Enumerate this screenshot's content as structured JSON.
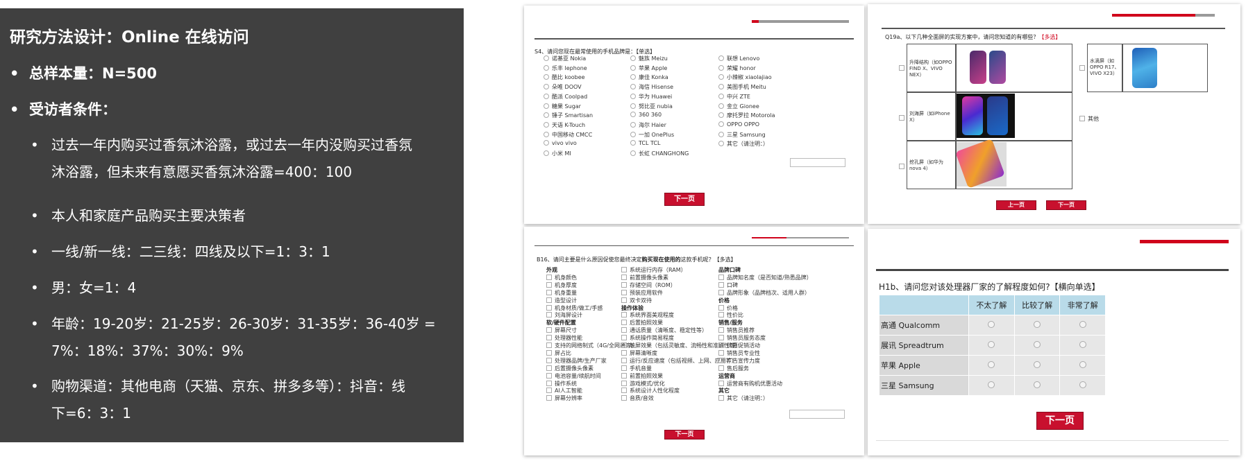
{
  "slide": {
    "title": "研究方法设计：Online 在线访问",
    "bullets": [
      {
        "dot": "•",
        "text": "总样本量：N=500"
      },
      {
        "dot": "•",
        "text": "受访者条件："
      }
    ],
    "sub_bullets": [
      {
        "dot": "•",
        "line1": "过去一年内购买过香氛沐浴露，或过去一年内没购买过香氛",
        "line2": "沐浴露，但未来有意愿买香氛沐浴露=400：100"
      },
      {
        "dot": "•",
        "line1": "本人和家庭产品购买主要决策者",
        "line2": ""
      },
      {
        "dot": "•",
        "line1": "一线/新一线：二三线：四线及以下=1：3：1",
        "line2": ""
      },
      {
        "dot": "•",
        "line1": "男：女=1：4",
        "line2": ""
      },
      {
        "dot": "•",
        "line1": "年龄：19-20岁：21-25岁：26-30岁：31-35岁：36-40岁 =",
        "line2": "7%：18%：37%：30%：9%"
      },
      {
        "dot": "•",
        "line1": "购物渠道：其他电商（天猫、京东、拼多多等）：抖音：线",
        "line2": "下=6：3：1"
      }
    ]
  },
  "s4": {
    "question": "S4、请问您现在最常使用的手机品牌是：【单选】",
    "col1": [
      "诺基亚 Nokia",
      "乐丰 lephone",
      "酷比 koobee",
      "朵唯 DOOV",
      "酷派 Coolpad",
      "糖果 Sugar",
      "锤子 Smartisan",
      "天语 K-Touch",
      "中国移动 CMCC",
      "vivo vivo",
      "小米 MI"
    ],
    "col2": [
      "魅族 Meizu",
      "苹果 Apple",
      "康佳 Konka",
      "海信 Hisense",
      "华为 Huawei",
      "努比亚 nubia",
      "360 360",
      "海尔 Haier",
      "一加 OnePlus",
      "TCL TCL",
      "长虹 CHANGHONG"
    ],
    "col3": [
      "联想 Lenovo",
      "荣耀 honor",
      "小辣椒 xiaolajiao",
      "美图手机 Meitu",
      "中兴 ZTE",
      "金立 Gionee",
      "摩托罗拉 Motorola",
      "OPPO OPPO",
      "三星 Samsung",
      "其它（请注明：）"
    ],
    "next_label": "下一页"
  },
  "q19a": {
    "question": "Q19a、以下几种全面屏的实现方案中，请问您知道的有哪些？",
    "tag": "【多选】",
    "options": [
      {
        "line1": "升降结构（如OPPO",
        "line2": "FIND X、VIVO",
        "line3": "NEX）"
      },
      {
        "line1": "水滴屏（如",
        "line2": "OPPO R17、",
        "line3": "VIVO X23）"
      },
      {
        "line1": "刘海屏（如iPhone",
        "line2": "X）",
        "line3": ""
      },
      {
        "line1": "挖孔屏（如华为",
        "line2": "nova 4）",
        "line3": ""
      }
    ],
    "other_label": "其他",
    "prev_label": "上一页",
    "next_label": "下一页"
  },
  "b16": {
    "question_pre": "B16、请问主要是什么原因促使您最终决定",
    "question_bold": "购买现在使用的",
    "question_post": "这款手机呢？【多选】",
    "col1": [
      {
        "t": "g",
        "v": "外观"
      },
      {
        "t": "o",
        "v": "机身颜色"
      },
      {
        "t": "o",
        "v": "机身厚度"
      },
      {
        "t": "o",
        "v": "机身重量"
      },
      {
        "t": "o",
        "v": "造型设计"
      },
      {
        "t": "o",
        "v": "机身材质/做工/手感"
      },
      {
        "t": "o",
        "v": "刘海屏设计"
      },
      {
        "t": "g",
        "v": "软/硬件配置"
      },
      {
        "t": "o",
        "v": "屏幕尺寸"
      },
      {
        "t": "o",
        "v": "处理器性能"
      },
      {
        "t": "o",
        "v": "支持的网络制式（4G/全网通等）"
      },
      {
        "t": "o",
        "v": "屏占比"
      },
      {
        "t": "o",
        "v": "处理器品牌/生产厂家"
      },
      {
        "t": "o",
        "v": "后置摄像头像素"
      },
      {
        "t": "o",
        "v": "电池容量/续航时间"
      },
      {
        "t": "o",
        "v": "操作系统"
      },
      {
        "t": "o",
        "v": "AI人工智能"
      },
      {
        "t": "o",
        "v": "屏幕分辨率"
      }
    ],
    "col2": [
      {
        "t": "o",
        "v": "系统运行内存（RAM）"
      },
      {
        "t": "o",
        "v": "前置摄像头像素"
      },
      {
        "t": "o",
        "v": "存储空间（ROM）"
      },
      {
        "t": "o",
        "v": "预装应用软件"
      },
      {
        "t": "o",
        "v": "双卡双待"
      },
      {
        "t": "g",
        "v": "操作体验"
      },
      {
        "t": "o",
        "v": "系统界面美观程度"
      },
      {
        "t": "o",
        "v": "后置拍照效果"
      },
      {
        "t": "o",
        "v": "通话质量（清晰度、稳定性等）"
      },
      {
        "t": "o",
        "v": "系统操作简易程度"
      },
      {
        "t": "o",
        "v": "触屏效果（包括灵敏度、流畅性和准确性等）"
      },
      {
        "t": "o",
        "v": "屏幕清晰度"
      },
      {
        "t": "o",
        "v": "运行/反应速度（包括视频、上网、应用等）"
      },
      {
        "t": "o",
        "v": "手机音量"
      },
      {
        "t": "o",
        "v": "前置拍照效果"
      },
      {
        "t": "o",
        "v": "游戏模式/优化"
      },
      {
        "t": "o",
        "v": "系统设计人性化程度"
      },
      {
        "t": "o",
        "v": "音质/音效"
      }
    ],
    "col3": [
      {
        "t": "g",
        "v": "品牌口碑"
      },
      {
        "t": "o",
        "v": "品牌知名度（是否知道/熟悉品牌）"
      },
      {
        "t": "o",
        "v": "口碑"
      },
      {
        "t": "o",
        "v": "品牌形象（品牌档次、适用人群）"
      },
      {
        "t": "g",
        "v": "价格"
      },
      {
        "t": "o",
        "v": "价格"
      },
      {
        "t": "o",
        "v": "性价比"
      },
      {
        "t": "g",
        "v": "销售/服务"
      },
      {
        "t": "o",
        "v": "销售员推荐"
      },
      {
        "t": "o",
        "v": "销售员服务态度"
      },
      {
        "t": "o",
        "v": "优惠促销活动"
      },
      {
        "t": "o",
        "v": "销售员专业性"
      },
      {
        "t": "o",
        "v": "广告宣传力度"
      },
      {
        "t": "o",
        "v": "售后服务"
      },
      {
        "t": "g",
        "v": "运营商"
      },
      {
        "t": "o",
        "v": "运营商有购机优惠活动"
      },
      {
        "t": "g",
        "v": "其它"
      },
      {
        "t": "o",
        "v": "其它（请注明：）"
      }
    ],
    "next_label": "下一页"
  },
  "h1b": {
    "question": "H1b、请问您对该处理器厂家的了解程度如何?【横向单选】",
    "columns": [
      "不太了解",
      "比较了解",
      "非常了解"
    ],
    "rows": [
      "高通 Qualcomm",
      "展讯 Spreadtrum",
      "苹果 Apple",
      "三星 Samsung"
    ],
    "next_label": "下一页"
  },
  "colors": {
    "panel": "#404040",
    "accent_red": "#c8102e",
    "table_header": "#b9dbe9"
  }
}
